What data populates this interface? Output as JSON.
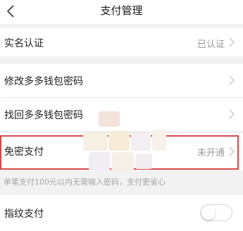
{
  "nav": {
    "title": "支付管理",
    "back_icon": "chevron-left-icon"
  },
  "rows": {
    "real_name": {
      "label": "实名认证",
      "value": "已认证"
    },
    "change_password": {
      "label": "修改多多钱包密码"
    },
    "recover_password": {
      "label": "找回多多钱包密码"
    },
    "password_free": {
      "label": "免密支付",
      "value": "未开通"
    },
    "fingerprint": {
      "label": "指纹支付",
      "enabled": false
    }
  },
  "hint": "单笔支付100元以内无需输入密码，支付更省心",
  "colors": {
    "highlight_border": "#d94848",
    "muted_text": "#9a9a9a",
    "background": "#f2f2f2"
  }
}
